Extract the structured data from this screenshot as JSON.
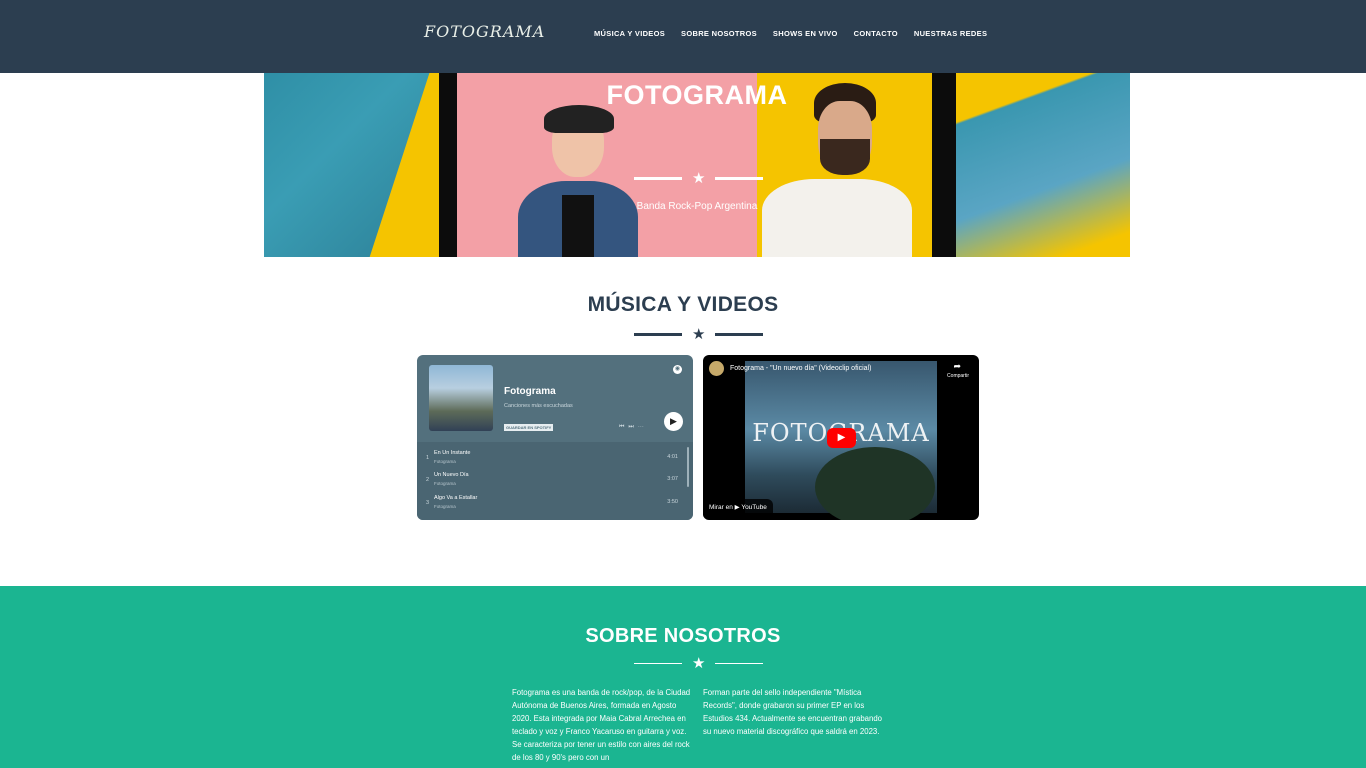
{
  "nav": {
    "logo": "FOTOGRAMA",
    "items": [
      "MÚSICA Y VIDEOS",
      "SOBRE NOSOTROS",
      "SHOWS EN VIVO",
      "CONTACTO",
      "NUESTRAS REDES"
    ]
  },
  "hero": {
    "title": "FOTOGRAMA",
    "subtitle": "Banda Rock-Pop Argentina"
  },
  "music": {
    "title": "MÚSICA Y VIDEOS",
    "spotify": {
      "playlist_name": "Fotograma",
      "playlist_sub": "Canciones más escuchadas",
      "badge": "GUARDAR EN SPOTIFY",
      "tracks": [
        {
          "num": "1",
          "name": "En Un Instante",
          "artist": "Fotograma",
          "duration": "4:01"
        },
        {
          "num": "2",
          "name": "Un Nuevo Día",
          "artist": "Fotograma",
          "duration": "3:07"
        },
        {
          "num": "3",
          "name": "Algo Va a Estallar",
          "artist": "Fotograma",
          "duration": "3:50"
        }
      ]
    },
    "youtube": {
      "video_title": "Fotograma - \"Un nuevo día\" (Videoclip oficial)",
      "share_label": "Compartir",
      "overlay_word": "FOTOGRAMA",
      "watch_label": "Mirar en ▶ YouTube"
    }
  },
  "about": {
    "title": "SOBRE NOSOTROS",
    "col1": "Fotograma es una banda de rock/pop, de la Ciudad Autónoma de Buenos Aires, formada en Agosto 2020. Esta integrada por Maia Cabral Arrechea en teclado y voz y Franco Yacaruso en guitarra y voz. Se caracteriza por tener un estilo con aires del rock de los 80 y 90's pero con un",
    "col2": "Forman parte del sello independiente \"Mística Records\", donde grabaron su primer EP en los Estudios 434. Actualmente se encuentran grabando su nuevo material discográfico que saldrá en 2023."
  },
  "colors": {
    "nav_bg": "#2c3e50",
    "accent": "#1bb591",
    "heading": "#2c3e50"
  }
}
